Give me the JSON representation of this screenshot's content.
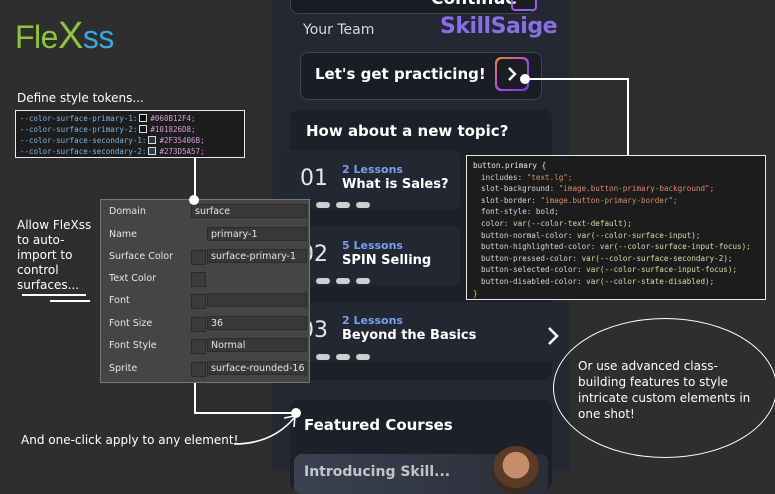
{
  "logo": {
    "part1": "Fle",
    "part2": "X",
    "part3": "ss"
  },
  "annotations": {
    "define_tokens": "Define style tokens...",
    "allow_import": [
      "Allow FleXss",
      "to auto-",
      "import to",
      "control",
      "surfaces..."
    ],
    "one_click": "And one-click apply to any element!",
    "advanced": [
      "Or use advanced class-",
      "building features to style",
      "intricate custom elements in",
      "one shot!"
    ]
  },
  "tokens": [
    {
      "name": "--color-surface-primary-1:",
      "value": "#060B12F4;"
    },
    {
      "name": "--color-surface-primary-2:",
      "value": "#101826D8;"
    },
    {
      "name": "--color-surface-secondary-1:",
      "value": "#2F35406B;"
    },
    {
      "name": "--color-surface-secondary-2:",
      "value": "#273D5A57;"
    }
  ],
  "colors": {
    "token1": "#060B12",
    "token2": "#101826",
    "token3": "#2F3540",
    "token4": "#273D5A",
    "accent_orange": "#e8873a",
    "accent_purple": "#8a3fd1",
    "brand_green": "#8cc63f",
    "brand_blue": "#38a8e0"
  },
  "phone": {
    "continue_label": "Continue",
    "your_team": "Your Team",
    "brand": "SkillSaige",
    "practice_label": "Let's get practicing!",
    "new_topic_title": "How about a new topic?",
    "topics": [
      {
        "number": "01",
        "lessons": "2 Lessons",
        "title": "What is Sales?"
      },
      {
        "number": "02",
        "lessons": "5 Lessons",
        "title": "SPIN Selling"
      },
      {
        "number": "03",
        "lessons": "2 Lessons",
        "title": "Beyond the Basics"
      }
    ],
    "featured_title": "Featured Courses",
    "featured_partial": "Introducing Skill..."
  },
  "inspector": {
    "rows": [
      {
        "label": "Domain",
        "value": "surface"
      },
      {
        "label": "Name",
        "value": "primary-1"
      },
      {
        "label": "Surface Color",
        "value": "surface-primary-1"
      },
      {
        "label": "Text Color",
        "value": ""
      },
      {
        "label": "Font",
        "value": ""
      },
      {
        "label": "Font Size",
        "value": "36"
      },
      {
        "label": "Font Style",
        "value": "Normal"
      },
      {
        "label": "Sprite",
        "value": "surface-rounded-16"
      }
    ]
  },
  "code": {
    "selector": "button.primary {",
    "lines": [
      {
        "prop": "includes: ",
        "val": "\"text.lg\";",
        "kind": "str"
      },
      {
        "prop": "slot-background: ",
        "val": "\"image.button-primary-background\";",
        "kind": "str"
      },
      {
        "prop": "slot-border: ",
        "val": "\"image.button-primary-border\";",
        "kind": "str"
      },
      {
        "prop": "font-style: ",
        "val": "bold;",
        "kind": "plain"
      },
      {
        "prop": "color: ",
        "val": "var(--color-text-default);",
        "kind": "var"
      },
      {
        "prop": "button-normal-color: ",
        "val": "var(--color-surface-input);",
        "kind": "var"
      },
      {
        "prop": "button-highlighted-color: ",
        "val": "var(--color-surface-input-focus);",
        "kind": "var"
      },
      {
        "prop": "button-pressed-color: ",
        "val": "var(--color-surface-secondary-2);",
        "kind": "var"
      },
      {
        "prop": "button-selected-color: ",
        "val": "var(--color-surface-input-focus);",
        "kind": "var"
      },
      {
        "prop": "button-disabled-color: ",
        "val": "var(--color-state-disabled);",
        "kind": "var"
      }
    ],
    "close": "}"
  }
}
